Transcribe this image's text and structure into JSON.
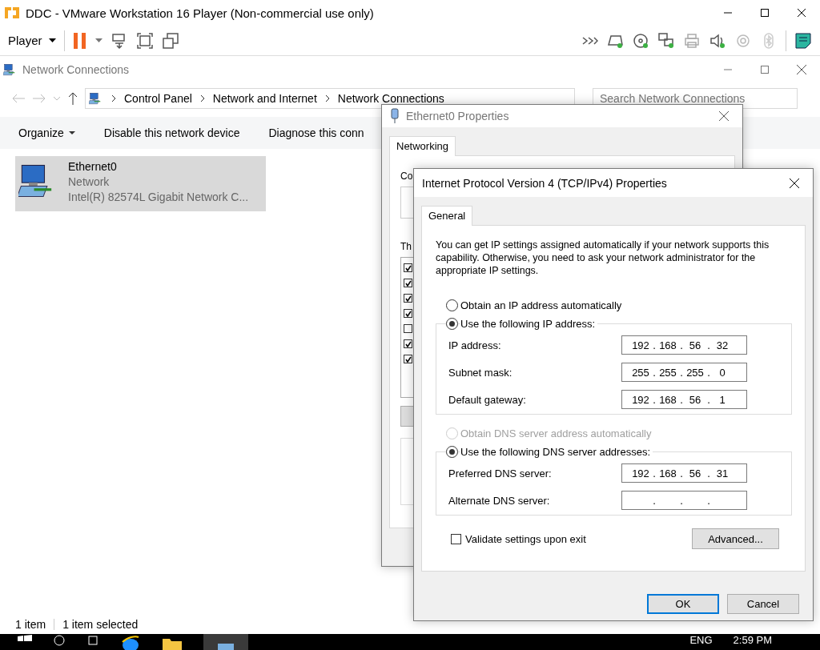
{
  "vm_window": {
    "title": "DDC - VMware Workstation 16 Player (Non-commercial use only)",
    "menu": "Player"
  },
  "explorer": {
    "title": "Network Connections",
    "breadcrumb": [
      "Control Panel",
      "Network and Internet",
      "Network Connections"
    ],
    "search": {
      "placeholder": "Search Network Connections"
    },
    "commands": [
      {
        "label": "Organize",
        "dropdown": true
      },
      {
        "label": "Disable this network device",
        "dropdown": false
      },
      {
        "label": "Diagnose this conn",
        "dropdown": false
      }
    ],
    "items": [
      {
        "name": "Ethernet0",
        "status": "Network",
        "device": "Intel(R) 82574L Gigabit Network C...",
        "selected": true
      }
    ],
    "status_bar": [
      "1 item",
      "1 item selected"
    ]
  },
  "properties_dialog": {
    "title": "Ethernet0 Properties",
    "tabs": [
      {
        "label": "Networking",
        "selected": true
      }
    ],
    "connect_label": "Co",
    "components_label": "Th",
    "components": [
      {
        "checked": true
      },
      {
        "checked": true
      },
      {
        "checked": true
      },
      {
        "checked": true
      },
      {
        "checked": false
      },
      {
        "checked": true
      },
      {
        "checked": true
      }
    ]
  },
  "ipv4_dialog": {
    "title": "Internet Protocol Version 4 (TCP/IPv4) Properties",
    "tabs": [
      {
        "label": "General",
        "selected": true
      }
    ],
    "intro": "You can get IP settings assigned automatically if your network supports this capability. Otherwise, you need to ask your network administrator for the appropriate IP settings.",
    "ip_options": [
      {
        "label": "Obtain an IP address automatically",
        "selected": false,
        "disabled": false
      },
      {
        "label": "Use the following IP address:",
        "selected": true,
        "disabled": false
      }
    ],
    "ip_fields": [
      {
        "label": "IP address:",
        "octets": [
          "192",
          "168",
          "56",
          "32"
        ]
      },
      {
        "label": "Subnet mask:",
        "octets": [
          "255",
          "255",
          "255",
          "0"
        ]
      },
      {
        "label": "Default gateway:",
        "octets": [
          "192",
          "168",
          "56",
          "1"
        ]
      }
    ],
    "dns_options": [
      {
        "label": "Obtain DNS server address automatically",
        "selected": false,
        "disabled": true
      },
      {
        "label": "Use the following DNS server addresses:",
        "selected": true,
        "disabled": false
      }
    ],
    "dns_fields": [
      {
        "label": "Preferred DNS server:",
        "octets": [
          "192",
          "168",
          "56",
          "31"
        ]
      },
      {
        "label": "Alternate DNS server:"
      }
    ],
    "separator": ".",
    "validate": {
      "label": "Validate settings upon exit",
      "checked": false
    },
    "advanced": "Advanced...",
    "buttons": [
      {
        "label": "OK",
        "default": true
      },
      {
        "label": "Cancel",
        "default": false
      }
    ]
  },
  "taskbar": {
    "language": "ENG",
    "time": "2:59 PM"
  }
}
